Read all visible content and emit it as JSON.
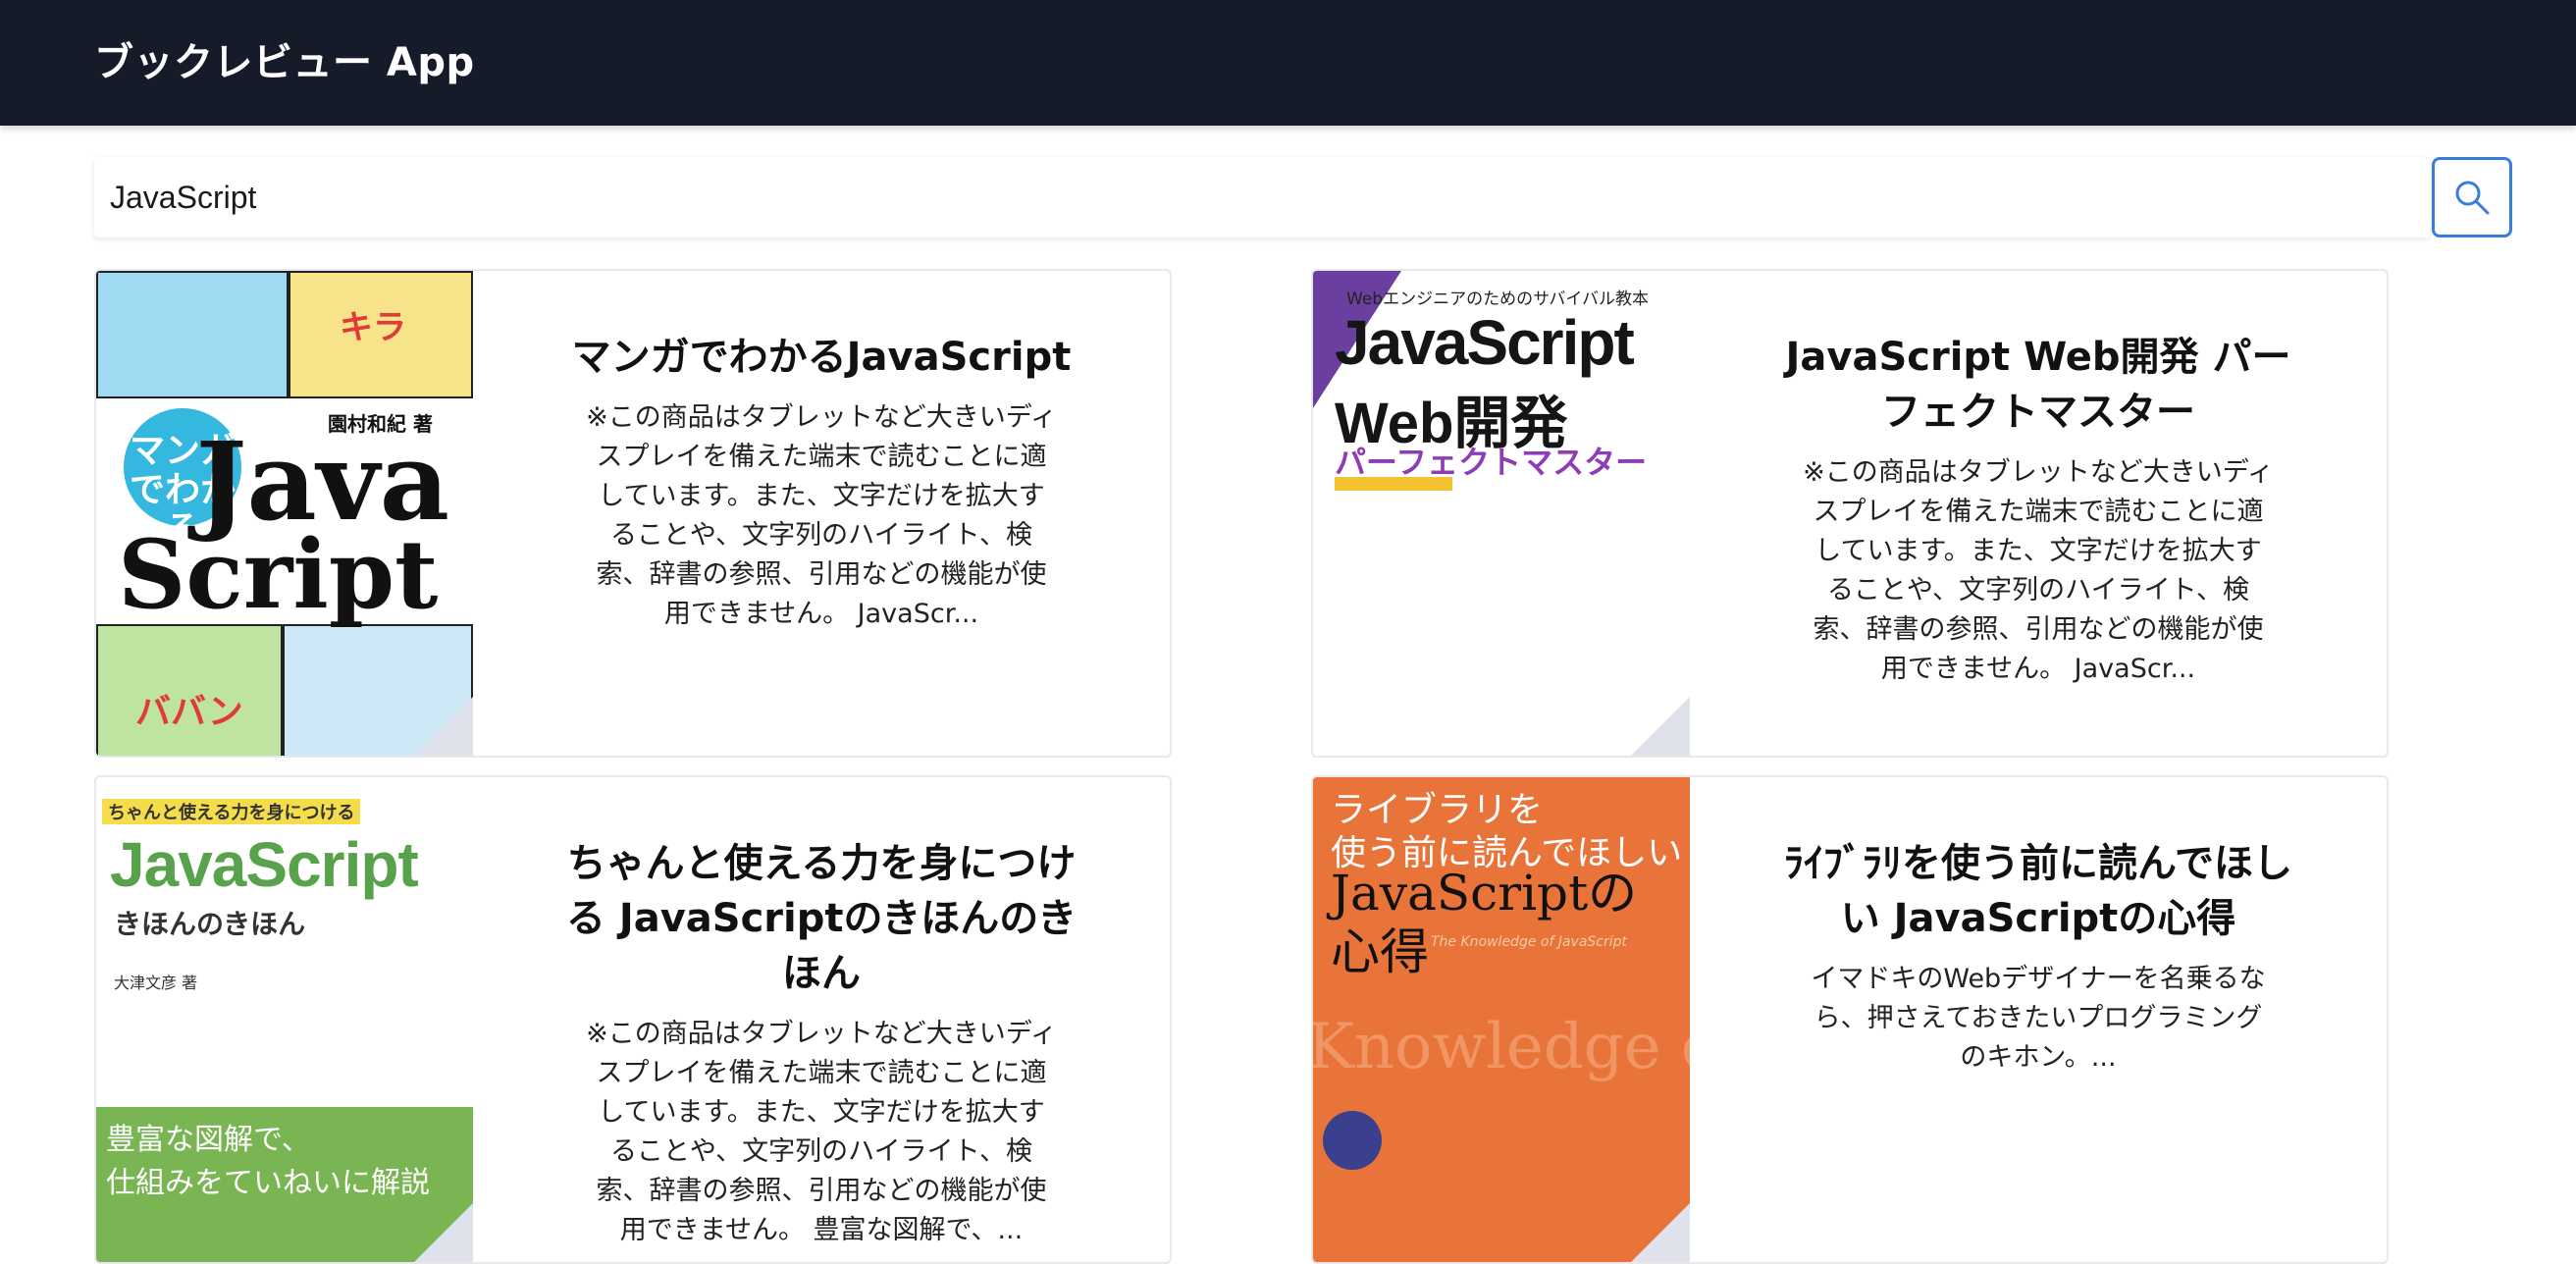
{
  "app": {
    "title": "ブックレビュー App"
  },
  "search": {
    "value": "JavaScript",
    "button_icon": "search-icon",
    "accent": "#3b7ddd"
  },
  "colors": {
    "header_bg": "#161b2a"
  },
  "books": [
    {
      "title": "マンガでわかるJavaScript",
      "description": "※この商品はタブレットなど大きいディスプレイを備えた端末で読むことに適しています。また、文字だけを拡大することや、文字列のハイライト、検索、辞書の参照、引用などの機能が使用できません。 JavaScr...",
      "cover": {
        "author": "園村和紀 著",
        "badge": "マンガでわかる",
        "title_line1": "Java",
        "title_line2": "Script",
        "sfx1": "キラ",
        "sfx2": "ババン"
      }
    },
    {
      "title": "JavaScript Web開発 パーフェクトマスター",
      "description": "※この商品はタブレットなど大きいディスプレイを備えた端末で読むことに適しています。また、文字だけを拡大することや、文字列のハイライト、検索、辞書の参照、引用などの機能が使用できません。 JavaScr...",
      "cover": {
        "tagline": "Webエンジニアのためのサバイバル教本",
        "title_line1": "JavaScript",
        "title_line2": "Web開発",
        "title_line3": "パーフェクトマスター"
      }
    },
    {
      "title": "ちゃんと使える力を身につける JavaScriptのきほんのきほん",
      "description": "※この商品はタブレットなど大きいディスプレイを備えた端末で読むことに適しています。また、文字だけを拡大することや、文字列のハイライト、検索、辞書の参照、引用などの機能が使用できません。 豊富な図解で、...",
      "cover": {
        "tagline": "ちゃんと使える力を身につける",
        "title_line1": "JavaScript",
        "title_line2": "きほんのきほん",
        "author": "大津文彦 著",
        "band": "豊富な図解で、\n仕組みをていねいに解説"
      }
    },
    {
      "title": "ﾗｲﾌﾞﾗﾘを使う前に読んでほしい JavaScriptの心得",
      "description": "イマドキのWebデザイナーを名乗るなら、押さえておきたいプログラミングのキホン。...",
      "cover": {
        "title_line1": "ライブラリを",
        "title_line2": "使う前に読んでほしい",
        "title_line3": "JavaScriptの",
        "title_line4": "心得",
        "subtitle": "The Knowledge of JavaScript",
        "ghost": "Knowledge of JavaScript The Kn"
      }
    }
  ]
}
